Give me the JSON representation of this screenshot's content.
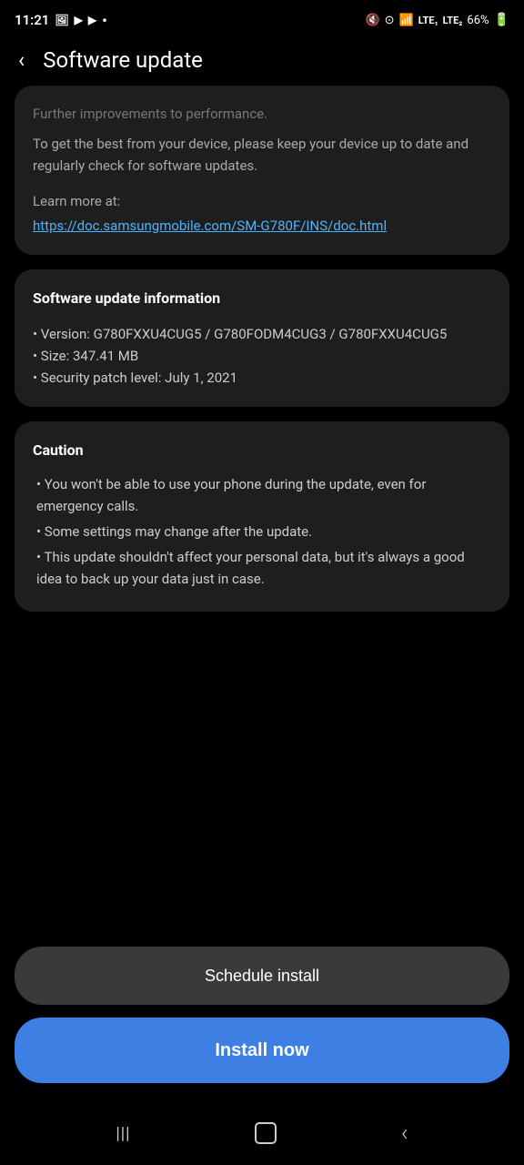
{
  "statusBar": {
    "time": "11:21",
    "battery": "66%",
    "batteryIcon": "🔋"
  },
  "header": {
    "backLabel": "‹",
    "title": "Software update"
  },
  "descriptionCard": {
    "partialText": "Further improvements to performance.",
    "body": "To get the best from your device, please keep your device up to date and regularly check for software updates.",
    "learnMore": "Learn more at:",
    "link": "https://doc.samsungmobile.com/SM-G780F/INS/doc.html"
  },
  "updateInfoCard": {
    "title": "Software update information",
    "version": "• Version: G780FXXU4CUG5 / G780FODM4CUG3 / G780FXXU4CUG5",
    "size": "• Size: 347.41 MB",
    "security": "• Security patch level: July 1, 2021"
  },
  "cautionCard": {
    "title": "Caution",
    "items": [
      "• You won't be able to use your phone during the update, even for emergency calls.",
      "• Some settings may change after the update.",
      "• This update shouldn't affect your personal data, but it's always a good idea to back up your data just in case."
    ]
  },
  "buttons": {
    "schedule": "Schedule install",
    "install": "Install now"
  },
  "navBar": {
    "recent": "|||",
    "home": "○",
    "back": "‹"
  }
}
